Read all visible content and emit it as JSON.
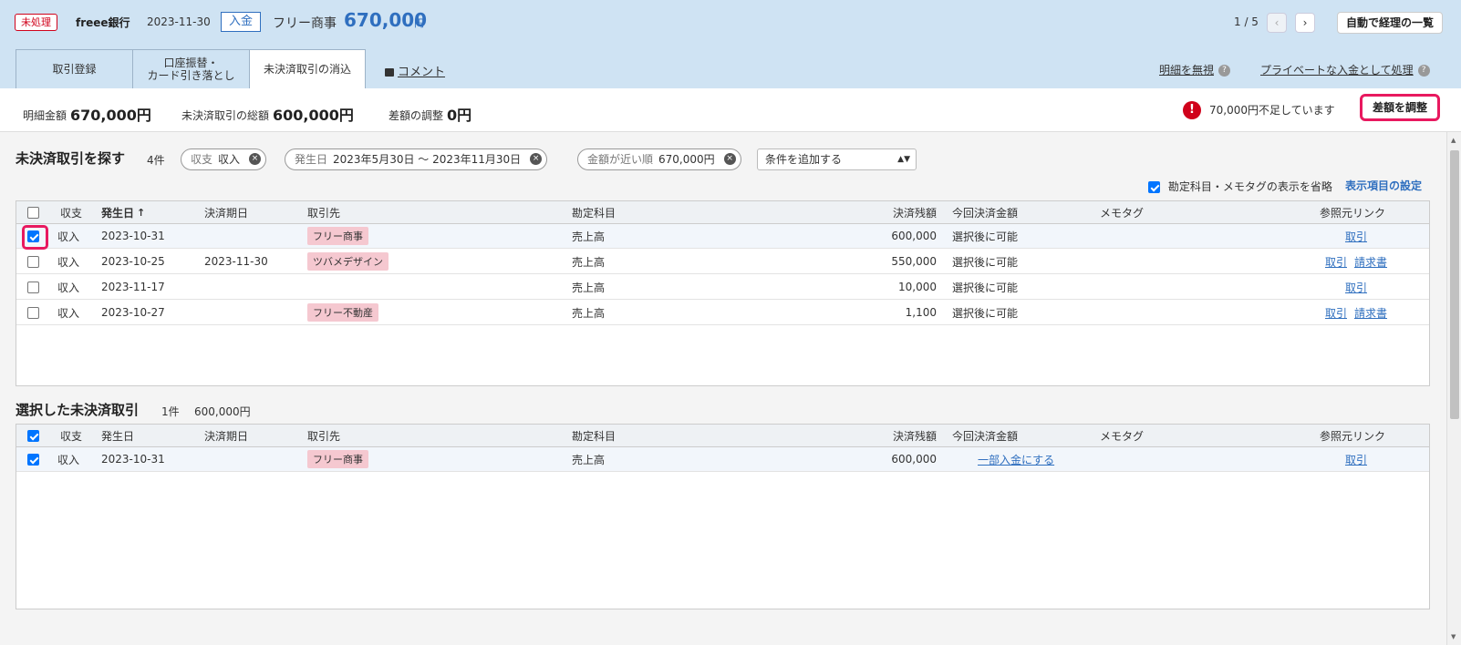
{
  "header": {
    "status": "未処理",
    "bank": "freee銀行",
    "date": "2023-11-30",
    "io": "入金",
    "partner": "フリー商事",
    "amount": "670,000",
    "yen": "円",
    "pager": "1 / 5",
    "prev": "‹",
    "next": "›",
    "list_button": "自動で経理の一覧",
    "tabs": [
      {
        "label": "取引登録"
      },
      {
        "label_line1": "口座振替・",
        "label_line2": "カード引き落とし"
      },
      {
        "label": "未決済取引の消込"
      }
    ],
    "comment": "コメント",
    "ignore_link": "明細を無視",
    "private_link": "プライベートな入金として処理",
    "help": "?"
  },
  "summary": {
    "detail_label": "明細金額",
    "detail_value": "670,000円",
    "unsettled_label": "未決済取引の総額",
    "unsettled_value": "600,000円",
    "adjust_label": "差額の調整",
    "adjust_value": "0円",
    "warning_icon": "!",
    "warning": "70,000円不足しています",
    "adjust_button": "差額を調整"
  },
  "search": {
    "title": "未決済取引を探す",
    "count": "4件",
    "chips": [
      {
        "key": "収支",
        "value": "収入"
      },
      {
        "key": "発生日",
        "value": "2023年5月30日 〜 2023年11月30日"
      },
      {
        "key": "金額が近い順",
        "value": "670,000円"
      }
    ],
    "chip_x": "×",
    "add_condition": "条件を追加する",
    "select_arrow": "▲▼",
    "omit_label": "勘定科目・メモタグの表示を省略",
    "settings_link": "表示項目の設定"
  },
  "columns": {
    "io": "収支",
    "date": "発生日",
    "sort": "↑",
    "due": "決済期日",
    "partner": "取引先",
    "account": "勘定科目",
    "balance": "決済残額",
    "payment": "今回決済金額",
    "memo": "メモタグ",
    "links": "参照元リンク"
  },
  "rows": [
    {
      "io": "収入",
      "date": "2023-10-31",
      "due": "",
      "partner": "フリー商事",
      "account": "売上高",
      "balance": "600,000",
      "payment": "選択後に可能",
      "link1": "",
      "link2": "取引"
    },
    {
      "io": "収入",
      "date": "2023-10-25",
      "due": "2023-11-30",
      "partner": "ツバメデザイン",
      "account": "売上高",
      "balance": "550,000",
      "payment": "選択後に可能",
      "link1": "取引",
      "link2": "請求書"
    },
    {
      "io": "収入",
      "date": "2023-11-17",
      "due": "",
      "partner": "",
      "account": "売上高",
      "balance": "10,000",
      "payment": "選択後に可能",
      "link1": "",
      "link2": "取引"
    },
    {
      "io": "収入",
      "date": "2023-10-27",
      "due": "",
      "partner": "フリー不動産",
      "account": "売上高",
      "balance": "1,100",
      "payment": "選択後に可能",
      "link1": "取引",
      "link2": "請求書"
    }
  ],
  "selected": {
    "title": "選択した未決済取引",
    "count": "1件",
    "total": "600,000円",
    "rows": [
      {
        "io": "収入",
        "date": "2023-10-31",
        "due": "",
        "partner": "フリー商事",
        "account": "売上高",
        "balance": "600,000",
        "payment_link": "一部入金にする",
        "link": "取引"
      }
    ]
  },
  "colors": {
    "accent_blue": "#2f6fbf",
    "header_bg": "#cfe3f3",
    "highlight_pink": "#e8195f",
    "warning_red": "#d0021b",
    "tag_pink": "#f5c8d0"
  }
}
